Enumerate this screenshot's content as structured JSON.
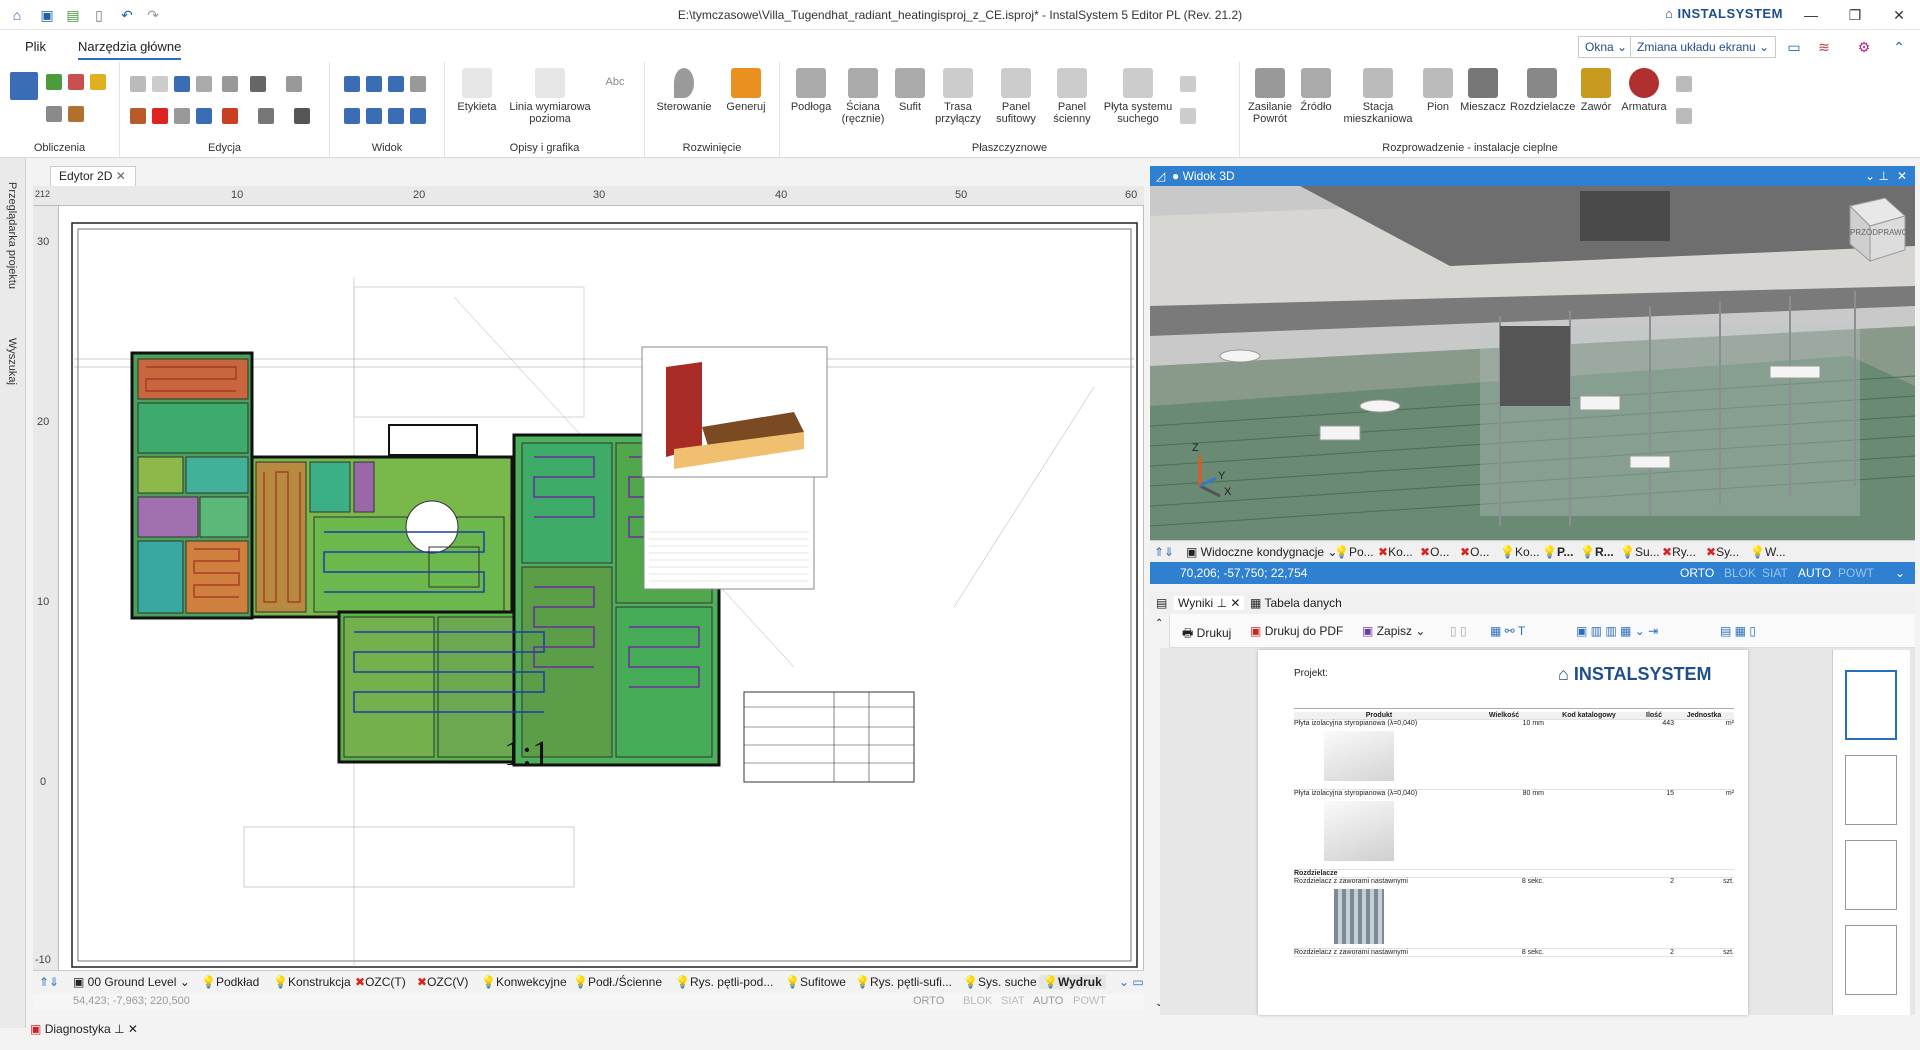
{
  "window": {
    "title": "E:\\tymczasowe\\Villa_Tugendhat_radiant_heatingisproj_z_CE.isproj* - InstalSystem 5 Editor PL (Rev. 21.2)",
    "brand": "INSTALSYSTEM"
  },
  "menu": {
    "tabs": [
      "Plik",
      "Narzędzia główne"
    ],
    "active": "Narzędzia główne",
    "okna": "Okna",
    "layout": "Zmiana układu ekranu"
  },
  "ribbon": {
    "groups": [
      {
        "label": "Obliczenia"
      },
      {
        "label": "Edycja"
      },
      {
        "label": "Widok"
      },
      {
        "label": "Opisy i grafika",
        "buttons": [
          "Etykieta",
          "Linia wymiarowa pozioma",
          "Abc"
        ]
      },
      {
        "label": "Rozwinięcie",
        "buttons": [
          "Sterowanie",
          "Generuj"
        ]
      },
      {
        "label": "Płaszczyznowe",
        "buttons": [
          "Podłoga",
          "Ściana (ręcznie)",
          "Sufit",
          "Trasa przyłączy",
          "Panel sufitowy",
          "Panel ścienny",
          "Płyta systemu suchego"
        ]
      },
      {
        "label": "Rozprowadzenie - instalacje cieplne",
        "buttons": [
          "Zasilanie Powrót",
          "Źródło",
          "Stacja mieszkaniowa",
          "Pion",
          "Mieszacz",
          "Rozdzielacze",
          "Zawór",
          "Armatura"
        ]
      }
    ]
  },
  "sidepanel": {
    "items": [
      "Przeglądarka projektu",
      "Wyszukaj"
    ]
  },
  "editor2d": {
    "tab": "Edytor 2D",
    "ruler_top": [
      "10",
      "20",
      "30",
      "40",
      "50",
      "60"
    ],
    "ruler_left": [
      "30",
      "20",
      "10",
      "0",
      "-10"
    ],
    "corner": "212",
    "scale_label": "1:1",
    "bottom_items": [
      "00 Ground Level",
      "Podkład",
      "Konstrukcja",
      "OZC(T)",
      "OZC(V)",
      "Konwekcyjne",
      "Podł./Ścienne",
      "Rys. pętli-pod...",
      "Sufitowe",
      "Rys. pętli-sufi...",
      "Sys. suche",
      "Wydruk"
    ],
    "coords": "54,423; -7,963; 220,500",
    "status": [
      "ORTO",
      "BLOK",
      "SIAT",
      "AUTO",
      "POWT"
    ]
  },
  "view3d": {
    "title": "Widok 3D",
    "cube_labels": [
      "PRZÓD",
      "PRAWO"
    ],
    "axes": [
      "Z",
      "Y",
      "X"
    ],
    "bar_items": [
      "Widoczne kondygnacje",
      "Po...",
      "Ko...",
      "O...",
      "O...",
      "Ko...",
      "P...",
      "R...",
      "Su...",
      "Ry...",
      "Sy...",
      "W..."
    ],
    "coords": "70,206; -57,750; 22,754",
    "status": [
      "ORTO",
      "BLOK",
      "SIAT",
      "AUTO",
      "POWT"
    ]
  },
  "results": {
    "tabs": [
      "Wyniki",
      "Tabela danych"
    ],
    "toolbar": [
      "Drukuj",
      "Drukuj do PDF",
      "Zapisz"
    ],
    "page": {
      "project_label": "Projekt:",
      "brand": "INSTALSYSTEM",
      "columns": [
        "Produkt",
        "Wielkość",
        "Kod katalogowy",
        "Ilość",
        "Jednostka"
      ],
      "rows": [
        {
          "product": "Płyta izolacyjna styropianowa (λ=0,040)",
          "size": "10 mm",
          "qty": "443",
          "unit": "m²"
        },
        {
          "product": "Płyta izolacyjna styropianowa (λ=0,040)",
          "size": "80 mm",
          "qty": "15",
          "unit": "m²"
        },
        {
          "product": "Rozdzielacz z zaworami nastawnymi",
          "size": "8 sekc.",
          "qty": "2",
          "unit": "szt."
        },
        {
          "product": "Rozdzielacz z zaworami nastawnymi",
          "size": "8 sekc.",
          "qty": "2",
          "unit": "szt."
        }
      ],
      "section": "Rozdzielacze"
    }
  },
  "bottom": {
    "diagnostics": "Diagnostyka"
  }
}
